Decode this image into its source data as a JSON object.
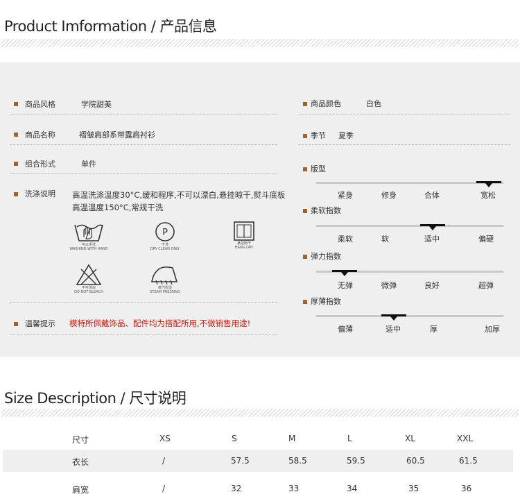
{
  "product_title": "Product Imformation / 产品信息",
  "info_left": {
    "style_label": "商品风格",
    "style_value": "学院甜美",
    "name_label": "商品名称",
    "name_value": "褶皱肩部系带露肩衬衫",
    "combo_label": "组合形式",
    "combo_value": "单件",
    "wash_label": "洗涤说明",
    "wash_text": "高温洗涤温度30°C,缓和程序,不可以漂白,悬挂晾干,熨斗底板高温温度150°C,常规干洗",
    "care_icons": [
      {
        "name": "hand-wash-icon",
        "cn": "可以手洗",
        "en": "WASHING WITH HAND"
      },
      {
        "name": "dry-clean-icon",
        "cn": "干洗",
        "en": "DRY CLEAN ONLY"
      },
      {
        "name": "hang-dry-icon",
        "cn": "悬挂晾干",
        "en": "HANG DRY"
      },
      {
        "name": "no-bleach-icon",
        "cn": "不可漂白",
        "en": "DO NOT BLEACH"
      },
      {
        "name": "steam-iron-icon",
        "cn": "蒸汽熨烫",
        "en": "STEAM PRESSING"
      }
    ],
    "warm_label": "温馨提示",
    "warm_text": "模特所佩戴饰品、配件均为搭配所用,不做销售用途!"
  },
  "info_right": {
    "color_label": "商品颜色",
    "color_value": "白色",
    "season_label": "季节",
    "season_value": "夏季",
    "scales": [
      {
        "label": "版型",
        "options": [
          "紧身",
          "修身",
          "合体",
          "宽松"
        ],
        "selected": 3
      },
      {
        "label": "柔软指数",
        "options": [
          "柔软",
          "软",
          "适中",
          "偏硬"
        ],
        "selected": 2
      },
      {
        "label": "弹力指数",
        "options": [
          "无弹",
          "微弹",
          "良好",
          "超弹"
        ],
        "selected": 0
      },
      {
        "label": "厚薄指数",
        "options": [
          "偏薄",
          "适中",
          "厚",
          "加厚"
        ],
        "selected": 1
      }
    ]
  },
  "size_title": "Size Description / 尺寸说明",
  "size_table": {
    "header": [
      "尺寸",
      "XS",
      "S",
      "M",
      "L",
      "XL",
      "XXL"
    ],
    "rows": [
      [
        "衣长",
        "/",
        "57.5",
        "58.5",
        "59.5",
        "60.5",
        "61.5"
      ],
      [
        "肩宽",
        "/",
        "32",
        "33",
        "34",
        "35",
        "36"
      ]
    ]
  },
  "colors": {
    "accent_brown": "#a0612d",
    "warning_red": "#d0190d",
    "panel_gray": "#efefef"
  }
}
